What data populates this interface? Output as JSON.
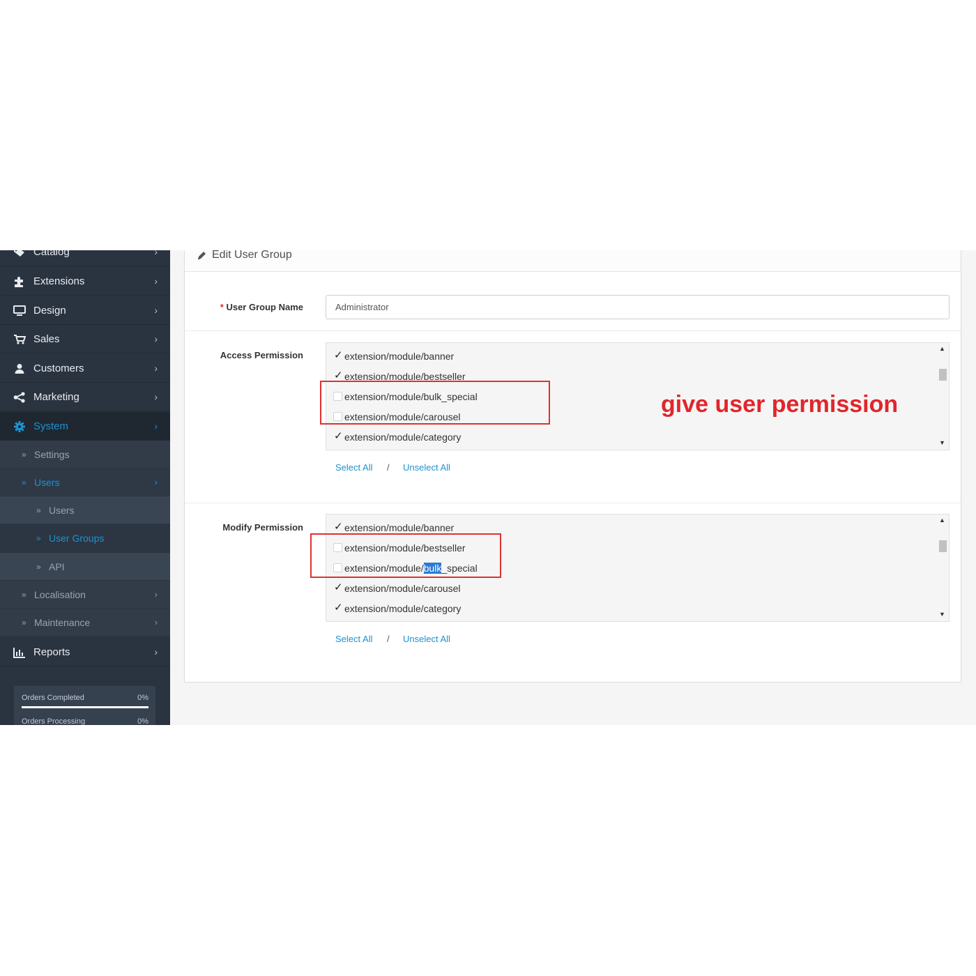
{
  "sidebar": {
    "items": [
      {
        "label": "Catalog",
        "icon": "tags-icon"
      },
      {
        "label": "Extensions",
        "icon": "puzzle-icon"
      },
      {
        "label": "Design",
        "icon": "monitor-icon"
      },
      {
        "label": "Sales",
        "icon": "cart-icon"
      },
      {
        "label": "Customers",
        "icon": "user-icon"
      },
      {
        "label": "Marketing",
        "icon": "share-icon"
      },
      {
        "label": "System",
        "icon": "gear-icon"
      },
      {
        "label": "Reports",
        "icon": "bar-chart-icon"
      }
    ],
    "system_sub": {
      "settings": "Settings",
      "users": "Users",
      "users_sub": [
        "Users",
        "User Groups",
        "API"
      ],
      "localisation": "Localisation",
      "maintenance": "Maintenance"
    },
    "progress": [
      {
        "label": "Orders Completed",
        "value": "0%",
        "fraction": 1.0
      },
      {
        "label": "Orders Processing",
        "value": "0%"
      }
    ]
  },
  "panel": {
    "title": "Edit User Group",
    "group_name": {
      "required_mark": "*",
      "label": "User Group Name",
      "value": "Administrator"
    },
    "access": {
      "label": "Access Permission",
      "items": [
        {
          "text": "extension/module/banner",
          "checked": true
        },
        {
          "text": "extension/module/bestseller",
          "checked": true
        },
        {
          "text": "extension/module/bulk_special",
          "checked": false
        },
        {
          "text": "extension/module/carousel",
          "checked": false
        },
        {
          "text": "extension/module/category",
          "checked": true
        }
      ],
      "select_all": "Select All",
      "separator": "/",
      "unselect_all": "Unselect All"
    },
    "modify": {
      "label": "Modify Permission",
      "items": [
        {
          "text": "extension/module/banner",
          "checked": true
        },
        {
          "text": "extension/module/bestseller",
          "checked": false
        },
        {
          "text": "extension/module/bulk_special",
          "checked": false,
          "parts": [
            "extension/module/",
            "bulk",
            "_special"
          ]
        },
        {
          "text": "extension/module/carousel",
          "checked": true
        },
        {
          "text": "extension/module/category",
          "checked": true
        }
      ],
      "select_all": "Select All",
      "separator": "/",
      "unselect_all": "Unselect All"
    }
  },
  "annotation": "give user permission",
  "colors": {
    "accent": "#1e91cf",
    "sidebar": "#2a3340",
    "annotation": "#e0262c"
  }
}
